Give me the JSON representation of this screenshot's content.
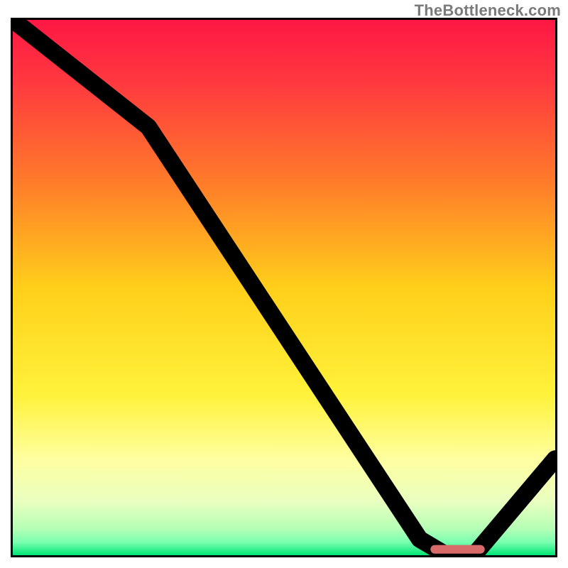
{
  "watermark": "TheBottleneck.com",
  "chart_data": {
    "type": "line",
    "title": "",
    "xlabel": "",
    "ylabel": "",
    "xlim": [
      0,
      100
    ],
    "ylim": [
      0,
      100
    ],
    "grid": false,
    "legend": false,
    "x": [
      0,
      25,
      75,
      80,
      85,
      100
    ],
    "values": [
      100,
      80,
      3,
      0,
      0,
      18
    ],
    "optimal_marker": {
      "x_start": 77,
      "x_end": 87,
      "color": "#d86a6a"
    },
    "background_gradient_stops": [
      {
        "pos": 0.0,
        "color": "#ff1744"
      },
      {
        "pos": 0.12,
        "color": "#ff3a3f"
      },
      {
        "pos": 0.3,
        "color": "#ff7a2a"
      },
      {
        "pos": 0.5,
        "color": "#ffcf1a"
      },
      {
        "pos": 0.7,
        "color": "#fff23a"
      },
      {
        "pos": 0.82,
        "color": "#ffffa0"
      },
      {
        "pos": 0.9,
        "color": "#e9ffc0"
      },
      {
        "pos": 0.95,
        "color": "#b6ffb6"
      },
      {
        "pos": 0.975,
        "color": "#7cffb0"
      },
      {
        "pos": 1.0,
        "color": "#00e676"
      }
    ]
  }
}
